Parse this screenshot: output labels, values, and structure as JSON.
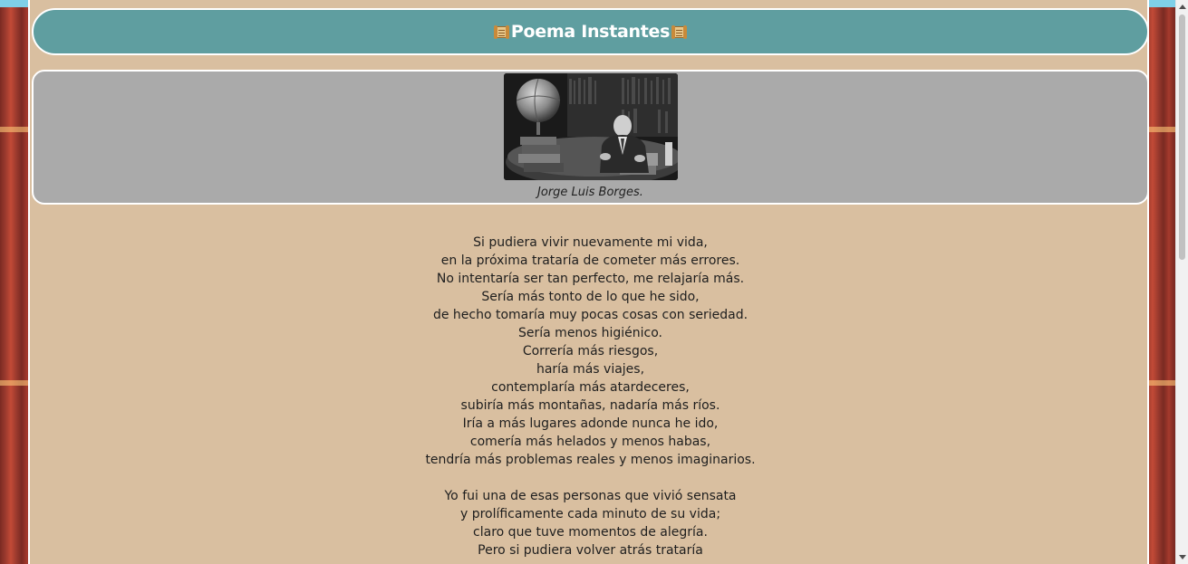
{
  "header": {
    "icon_left": "scroll-icon",
    "title": "Poema Instantes",
    "icon_right": "scroll-icon"
  },
  "photo": {
    "alt": "Jorge Luis Borges",
    "caption": "Jorge Luis Borges."
  },
  "poem": {
    "stanzas": [
      [
        "Si pudiera vivir nuevamente mi vida,",
        "en la próxima trataría de cometer más errores.",
        "No intentaría ser tan perfecto, me relajaría más.",
        "Sería más tonto de lo que he sido,",
        "de hecho tomaría muy pocas cosas con seriedad.",
        "Sería menos higiénico.",
        "Correría más riesgos,",
        "haría más viajes,",
        "contemplaría más atardeceres,",
        "subiría más montañas, nadaría más ríos.",
        "Iría a más lugares adonde nunca he ido,",
        "comería más helados y menos habas,",
        "tendría más problemas reales y menos imaginarios."
      ],
      [
        "Yo fui una de esas personas que vivió sensata",
        "y prolíficamente cada minuto de su vida;",
        "claro que tuve momentos de alegría.",
        "Pero si pudiera volver atrás trataría"
      ]
    ]
  },
  "colors": {
    "header_bg": "#5f9ea0",
    "page_bg": "#d9bfa0",
    "photo_box_bg": "#aaaaaa"
  }
}
